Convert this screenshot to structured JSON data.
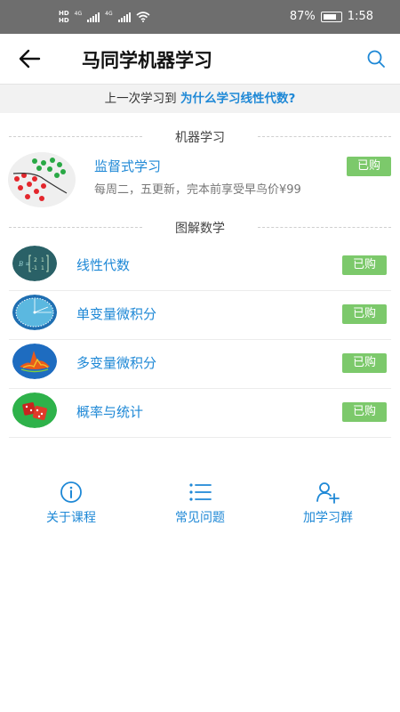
{
  "status_bar": {
    "hd_label": "HD",
    "net_label": "4G",
    "battery": "87%",
    "time": "1:58"
  },
  "header": {
    "title": "马同学机器学习",
    "back_icon": "arrow-left-icon",
    "search_icon": "search-icon"
  },
  "last_study": {
    "prefix": "上一次学习到",
    "link": "为什么学习线性代数?"
  },
  "sections": {
    "machine_learning": "机器学习",
    "graphic_math": "图解数学"
  },
  "featured_course": {
    "name": "监督式学习",
    "description": "每周二，五更新，完本前享受早鸟价¥99",
    "badge": "已购"
  },
  "math_courses": [
    {
      "name": "线性代数",
      "badge": "已购",
      "icon": "matrix-icon"
    },
    {
      "name": "单变量微积分",
      "badge": "已购",
      "icon": "calculus-circle-icon"
    },
    {
      "name": "多变量微积分",
      "badge": "已购",
      "icon": "surface-plot-icon"
    },
    {
      "name": "概率与统计",
      "badge": "已购",
      "icon": "dice-icon"
    }
  ],
  "bottom_nav": [
    {
      "label": "关于课程",
      "icon": "info-icon"
    },
    {
      "label": "常见问题",
      "icon": "list-icon"
    },
    {
      "label": "加学习群",
      "icon": "add-group-icon"
    }
  ],
  "colors": {
    "accent": "#1e88d6",
    "badge": "#7cc96b",
    "status_bar": "#6e6e6e"
  }
}
